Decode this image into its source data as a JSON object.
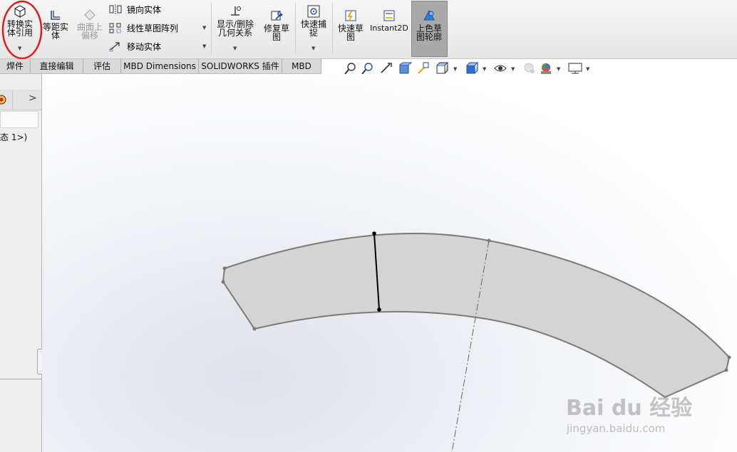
{
  "toolbar": {
    "convert_entities": "转换实\n体引用",
    "offset_entities": "等距实\n体",
    "surface_offset": "曲面上\n偏移",
    "mirror_entities": "镜向实体",
    "linear_pattern": "线性草图阵列",
    "move_entities": "移动实体",
    "display_relations": "显示/删除\n几何关系",
    "repair_sketch": "修复草\n图",
    "quick_snaps": "快速捕\n捉",
    "rapid_sketch": "快速草\n图",
    "instant2d": "Instant2D",
    "shaded_sketch": "上色草\n图轮廓"
  },
  "tabs": [
    "焊件",
    "直接编辑",
    "评估",
    "MBD Dimensions",
    "SOLIDWORKS 插件",
    "MBD"
  ],
  "side_panel": {
    "config_text": "态 1>)",
    "chevron": ">"
  },
  "watermark": {
    "brand": "Bai du 经验",
    "url": "jingyan.baidu.com"
  },
  "colors": {
    "shape_fill": "#d4d4d4",
    "shape_edge": "#7a7a7a",
    "highlight_circle": "#e21a1a"
  }
}
